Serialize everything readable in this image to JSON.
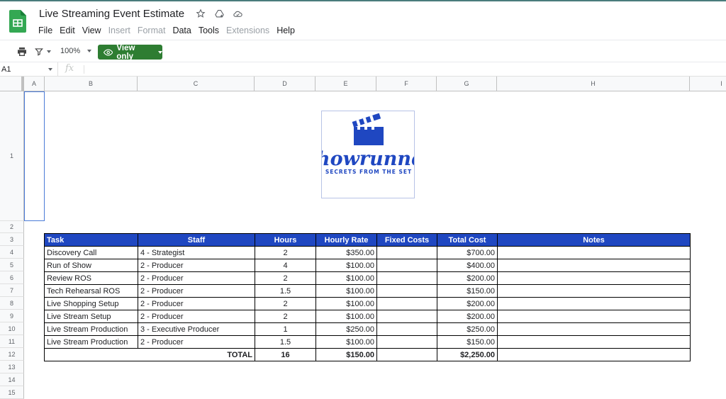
{
  "app": {
    "doc_title": "Live Streaming Event Estimate",
    "menu": [
      {
        "label": "File",
        "enabled": true
      },
      {
        "label": "Edit",
        "enabled": true
      },
      {
        "label": "View",
        "enabled": true
      },
      {
        "label": "Insert",
        "enabled": false
      },
      {
        "label": "Format",
        "enabled": false
      },
      {
        "label": "Data",
        "enabled": true
      },
      {
        "label": "Tools",
        "enabled": true
      },
      {
        "label": "Extensions",
        "enabled": false
      },
      {
        "label": "Help",
        "enabled": true
      }
    ],
    "title_icons": [
      "star-icon",
      "drive-add-icon",
      "cloud-status-icon"
    ]
  },
  "toolbar": {
    "zoom": "100%",
    "view_only_label": "View only"
  },
  "formula_bar": {
    "name_box": "A1",
    "fx_label": "fx",
    "value": ""
  },
  "sheet": {
    "columns": [
      "A",
      "B",
      "C",
      "D",
      "E",
      "F",
      "G",
      "H",
      "I"
    ],
    "rows": [
      "1",
      "2",
      "3",
      "4",
      "5",
      "6",
      "7",
      "8",
      "9",
      "10",
      "11",
      "12",
      "13",
      "14",
      "15"
    ],
    "selected_cell": "A1",
    "logo": {
      "brand": "Showrunner",
      "tagline": "SECRETS FROM THE SET",
      "color": "#1f47c1"
    }
  },
  "table": {
    "header_color": "#1f47c1",
    "headers": [
      "Task",
      "Staff",
      "Hours",
      "Hourly Rate",
      "Fixed Costs",
      "Total Cost",
      "Notes"
    ],
    "rows": [
      {
        "task": "Discovery Call",
        "staff": "4 - Strategist",
        "hours": "2",
        "rate": "$350.00",
        "fixed": "",
        "total": "$700.00",
        "notes": ""
      },
      {
        "task": "Run of Show",
        "staff": "2 - Producer",
        "hours": "4",
        "rate": "$100.00",
        "fixed": "",
        "total": "$400.00",
        "notes": ""
      },
      {
        "task": "Review ROS",
        "staff": "2 - Producer",
        "hours": "2",
        "rate": "$100.00",
        "fixed": "",
        "total": "$200.00",
        "notes": ""
      },
      {
        "task": "Tech Rehearsal ROS",
        "staff": "2 - Producer",
        "hours": "1.5",
        "rate": "$100.00",
        "fixed": "",
        "total": "$150.00",
        "notes": ""
      },
      {
        "task": "Live Shopping Setup",
        "staff": "2 - Producer",
        "hours": "2",
        "rate": "$100.00",
        "fixed": "",
        "total": "$200.00",
        "notes": ""
      },
      {
        "task": "Live Stream Setup",
        "staff": "2 - Producer",
        "hours": "2",
        "rate": "$100.00",
        "fixed": "",
        "total": "$200.00",
        "notes": ""
      },
      {
        "task": "Live Stream Production",
        "staff": "3 - Executive Producer",
        "hours": "1",
        "rate": "$250.00",
        "fixed": "",
        "total": "$250.00",
        "notes": ""
      },
      {
        "task": "Live Stream Production",
        "staff": "2 - Producer",
        "hours": "1.5",
        "rate": "$100.00",
        "fixed": "",
        "total": "$150.00",
        "notes": ""
      }
    ],
    "total": {
      "label": "TOTAL",
      "hours": "16",
      "rate": "$150.00",
      "fixed": "",
      "total": "$2,250.00",
      "notes": ""
    }
  }
}
